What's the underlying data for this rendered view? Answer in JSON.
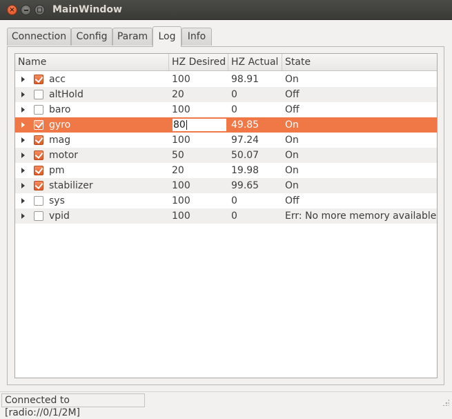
{
  "window": {
    "title": "MainWindow",
    "close_glyph": "×"
  },
  "tabs": [
    {
      "label": "Connection",
      "active": false
    },
    {
      "label": "Config",
      "active": false
    },
    {
      "label": "Param",
      "active": false
    },
    {
      "label": "Log",
      "active": true
    },
    {
      "label": "Info",
      "active": false
    }
  ],
  "table": {
    "columns": [
      "Name",
      "HZ Desired",
      "HZ Actual",
      "State"
    ],
    "rows": [
      {
        "name": "acc",
        "checked": true,
        "hz_desired": "100",
        "hz_actual": "98.91",
        "state": "On"
      },
      {
        "name": "altHold",
        "checked": false,
        "hz_desired": "20",
        "hz_actual": "0",
        "state": "Off"
      },
      {
        "name": "baro",
        "checked": false,
        "hz_desired": "100",
        "hz_actual": "0",
        "state": "Off"
      },
      {
        "name": "gyro",
        "checked": true,
        "hz_desired": "80",
        "hz_actual": "49.85",
        "state": "On",
        "selected": true,
        "editing": true
      },
      {
        "name": "mag",
        "checked": true,
        "hz_desired": "100",
        "hz_actual": "97.24",
        "state": "On"
      },
      {
        "name": "motor",
        "checked": true,
        "hz_desired": "50",
        "hz_actual": "50.07",
        "state": "On"
      },
      {
        "name": "pm",
        "checked": true,
        "hz_desired": "20",
        "hz_actual": "19.98",
        "state": "On"
      },
      {
        "name": "stabilizer",
        "checked": true,
        "hz_desired": "100",
        "hz_actual": "99.65",
        "state": "On"
      },
      {
        "name": "sys",
        "checked": false,
        "hz_desired": "100",
        "hz_actual": "0",
        "state": "Off"
      },
      {
        "name": "vpid",
        "checked": false,
        "hz_desired": "100",
        "hz_actual": "0",
        "state": "Err: No more memory available"
      }
    ]
  },
  "spin": {
    "up_glyph": "▲",
    "down_glyph": "▼"
  },
  "status": {
    "text": "Connected to [radio://0/1/2M]"
  },
  "colors": {
    "accent": "#f07746",
    "titlebar": "#3c3b37"
  }
}
